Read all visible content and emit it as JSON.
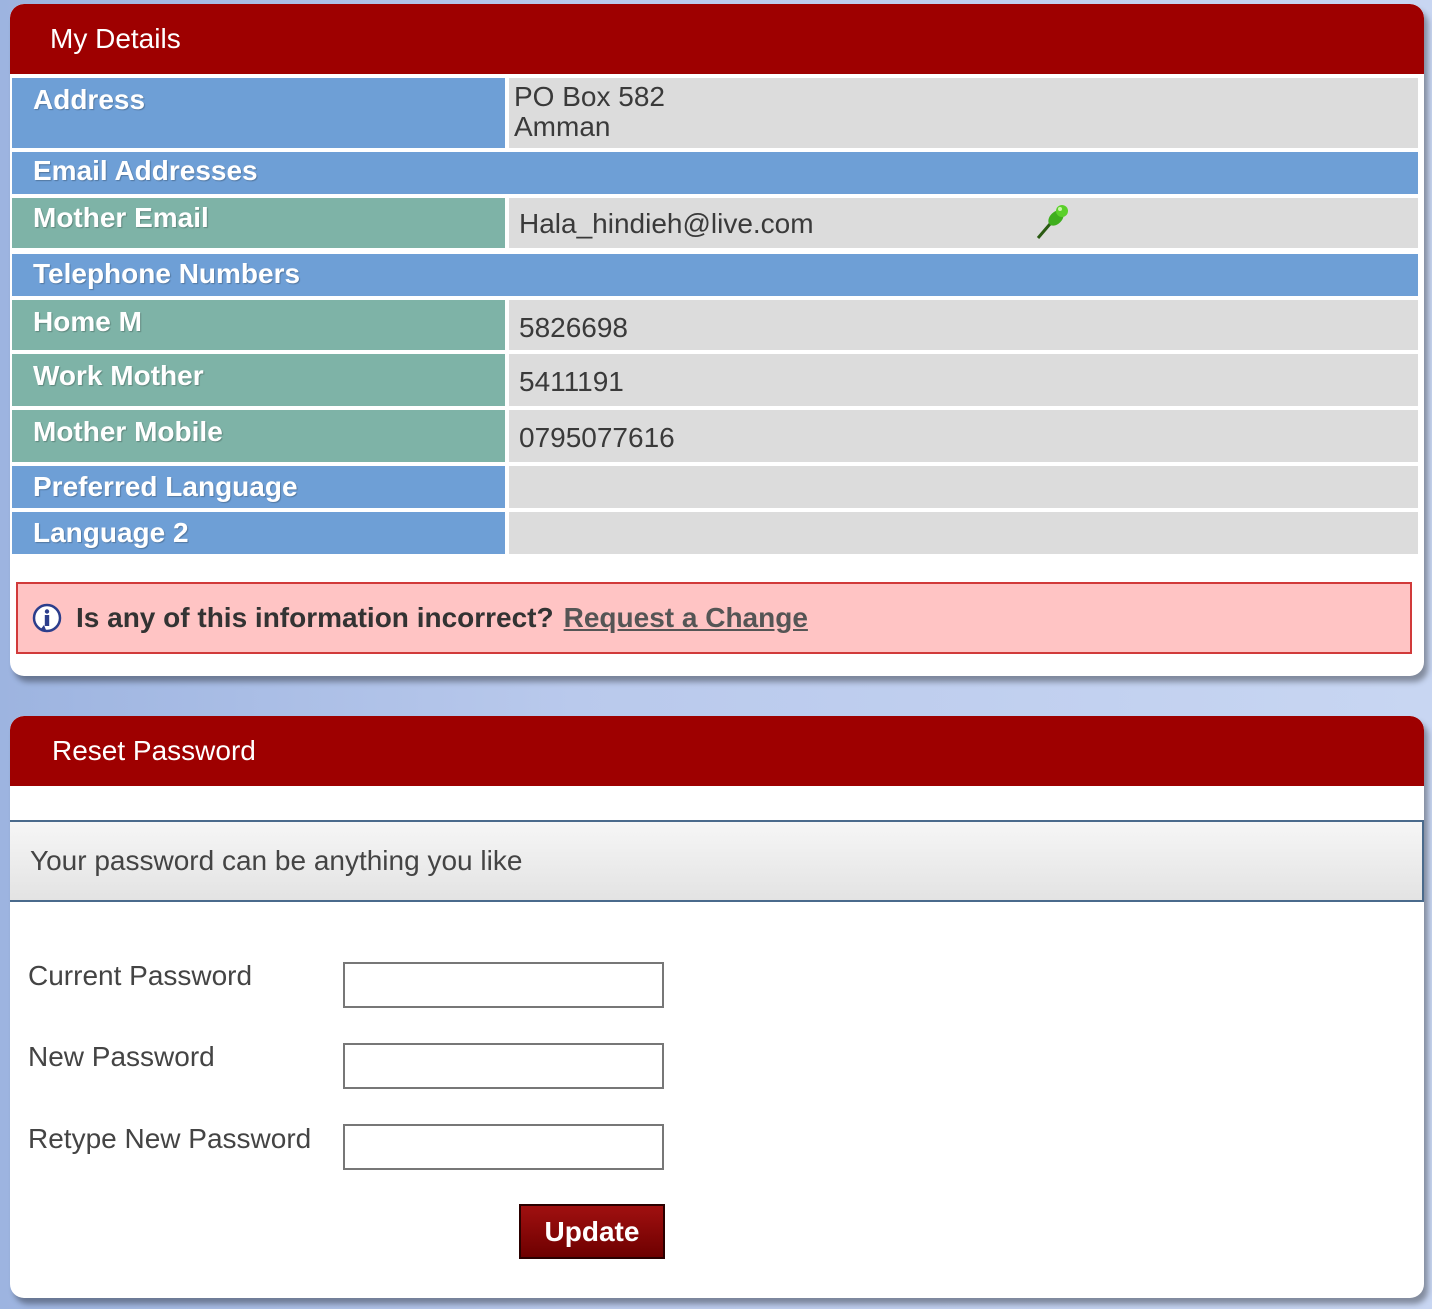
{
  "my_details": {
    "title": "My Details",
    "address_label": "Address",
    "address_line1": "PO Box 582",
    "address_line2": "Amman",
    "email_section": "Email Addresses",
    "mother_email_label": "Mother Email",
    "mother_email_value": "Hala_hindieh@live.com",
    "pin_icon": "green-pushpin-icon",
    "phone_section": "Telephone Numbers",
    "home_label": "Home M",
    "home_value": "5826698",
    "work_label": "Work Mother",
    "work_value": "5411191",
    "mobile_label": "Mother Mobile",
    "mobile_value": "0795077616",
    "pref_lang_label": "Preferred Language",
    "pref_lang_value": "",
    "lang2_label": "Language 2",
    "lang2_value": "",
    "notice_text": "Is any of this information incorrect?",
    "notice_link": "Request a Change"
  },
  "reset_password": {
    "title": "Reset Password",
    "hint": "Your password can be anything you like",
    "current_label": "Current Password",
    "new_label": "New Password",
    "retype_label": "Retype New Password",
    "current_value": "",
    "new_value": "",
    "retype_value": "",
    "update_button": "Update"
  },
  "colors": {
    "header_red": "#9e0000",
    "label_blue": "#6e9fd6",
    "label_teal": "#7eb3a7",
    "notice_pink": "#ffc4c4"
  }
}
